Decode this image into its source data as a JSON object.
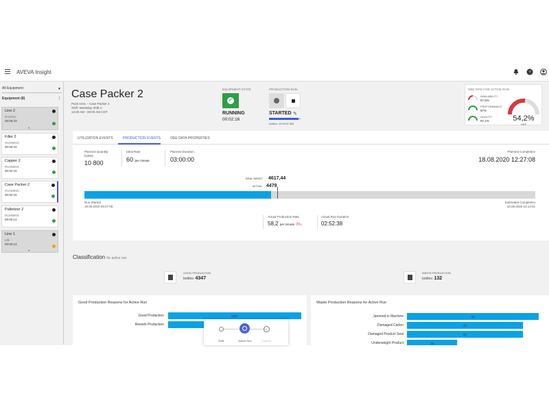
{
  "app": {
    "title": "AVEVA Insight"
  },
  "sidebar": {
    "filter": "All Equipment",
    "equipment_header": "Equipment (8)",
    "items": [
      {
        "name": "Line 2",
        "status": "Runtime",
        "time": "00:06:23",
        "state": "running",
        "grey": true,
        "expandable": true
      },
      {
        "name": "Filler 2",
        "status": "RUNNING",
        "time": "00:06:23",
        "state": "running"
      },
      {
        "name": "Capper 2",
        "status": "RUNNING",
        "time": "00:02:16",
        "state": "running"
      },
      {
        "name": "Case Packer 2",
        "status": "RUNNING",
        "time": "00:02:16",
        "state": "running",
        "selected": true
      },
      {
        "name": "Palletizer 2",
        "status": "RUNNING",
        "time": "00:00:14",
        "state": "running"
      },
      {
        "name": "Line 1",
        "status": "Idle",
        "time": "00:00:13",
        "state": "idle",
        "grey": true,
        "expandable": true
      }
    ]
  },
  "equipment": {
    "title": "Case Packer 2",
    "area": "Pack Area -- Case Packer 2",
    "shift": "Shift: Weekday Shift C",
    "window": "12:00 AM - 08:00 AM CDT",
    "state_label": "EQUIPMENT STATE",
    "state": "RUNNING",
    "state_time": "00:02:16",
    "run_label": "PRODUCTION RUN",
    "run_state": "STARTED",
    "run_progress": 0.93,
    "run_bottles": "bottles: 4479/10 800"
  },
  "oee": {
    "title": "OEE KPIs FOR ACTIVE RUN",
    "availability_label": "AVAILABILITY",
    "availability": "57,5%",
    "performance_label": "PERFORMANCE",
    "performance": "97%",
    "quality_label": "QUALITY",
    "quality": "97,1%",
    "oee_value": "54,2%",
    "oee_label": "OEE",
    "colors": {
      "availability": "#d9363e",
      "performance": "#2e9e47",
      "quality": "#2e9e47",
      "oee": "#d9363e"
    }
  },
  "tabs": [
    {
      "label": "UTILIZATION EVENTS",
      "active": false
    },
    {
      "label": "PRODUCTION EVENTS",
      "active": true
    },
    {
      "label": "OEE DATA PROPERTIES",
      "active": false
    }
  ],
  "production": {
    "planned_quantity_label": "Planned Quantity",
    "planned_quantity_unit": "bottles",
    "planned_quantity": "10 800",
    "ideal_rate_label": "Ideal Rate",
    "ideal_rate": "60",
    "ideal_rate_unit": "per minute",
    "planned_duration_label": "Planned Duration",
    "planned_duration": "03:00:00",
    "planned_completion_label": "Planned Completion",
    "planned_completion": "18.08.2020 12:27:08",
    "ideal_target_label": "IDEAL TARGET",
    "ideal_target": "4617,44",
    "actual_label": "ACTUAL",
    "actual": "4479",
    "bar_max": 10800,
    "run_started_label": "Run Started",
    "run_started": "18.08.2020 09:27:08",
    "estimated_completion_label": "Estimated Completion",
    "estimated_completion": "18.08.2020 14:14:01",
    "actual_rate_label": "Actual Production Rate",
    "actual_rate": "58,2",
    "actual_rate_unit": "per minute",
    "actual_rate_delta": "3%",
    "actual_duration_label": "Actual Run Duration",
    "actual_duration": "02:52:38"
  },
  "classification": {
    "title": "Classification",
    "subtitle": "for active run",
    "good_label": "GOOD PRODUCTION",
    "good_unit": "bottles:",
    "good_value": "4347",
    "waste_label": "WASTE PRODUCTION",
    "waste_unit": "bottles:",
    "waste_value": "132"
  },
  "dock": {
    "options": [
      {
        "label": "Shift",
        "active": false,
        "disabled": false
      },
      {
        "label": "Active Run",
        "active": true,
        "disabled": false
      },
      {
        "label": "Custom",
        "active": false,
        "disabled": true
      }
    ]
  },
  "chart_data": [
    {
      "type": "bar",
      "orientation": "horizontal",
      "title": "Good Production Reasons for Active Run",
      "categories": [
        "Good Production",
        "Rework Production"
      ],
      "values": [
        2347,
        2000
      ],
      "data_labels": [
        "2347",
        "2000"
      ],
      "color": "#0aa2e5",
      "xlim": [
        0,
        2347
      ]
    },
    {
      "type": "bar",
      "orientation": "horizontal",
      "title": "Waste Production Reasons for Active Run",
      "categories": [
        "Jammed in Machine",
        "Damaged Carton",
        "Damaged Product Seal",
        "Underweight Product"
      ],
      "values": [
        42,
        37,
        37,
        16
      ],
      "data_labels": [
        "42",
        "37",
        "37",
        "16"
      ],
      "color": "#0aa2e5",
      "xlim": [
        0,
        42
      ]
    }
  ]
}
